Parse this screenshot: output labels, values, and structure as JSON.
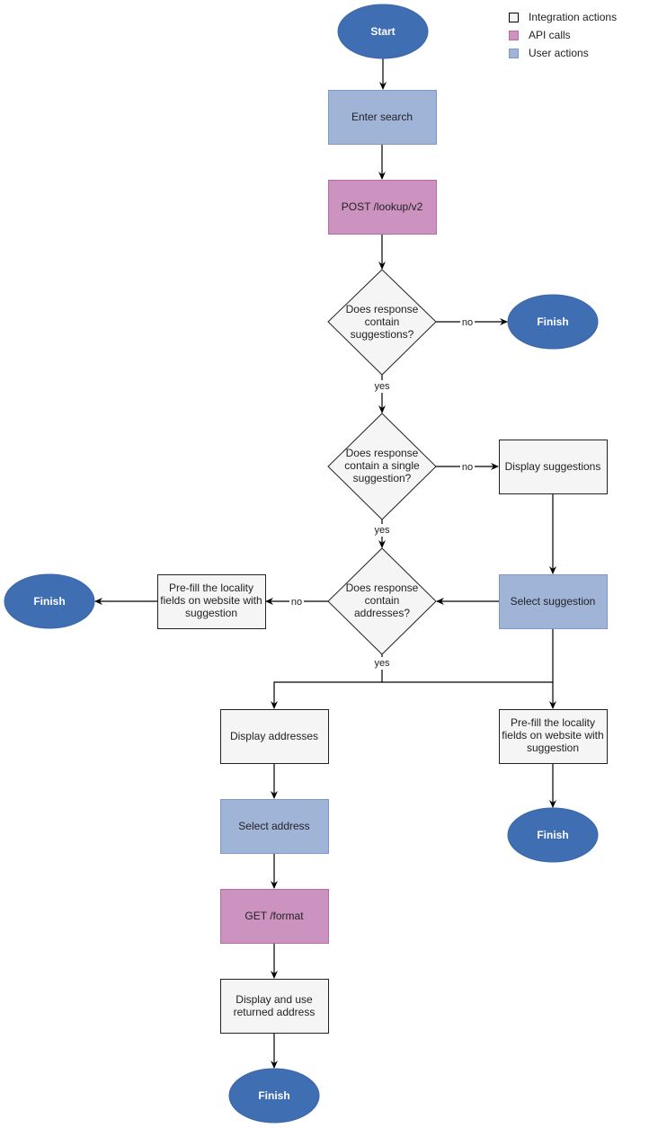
{
  "legend": [
    {
      "label": "Integration actions",
      "color": "#F5F5F5"
    },
    {
      "label": "API calls",
      "color": "#CC93C1"
    },
    {
      "label": "User actions",
      "color": "#A0B4D8"
    }
  ],
  "colors": {
    "terminal": "#3F6EB3",
    "integration": "#F5F5F5",
    "api": "#CC93C1",
    "user": "#A0B4D8"
  },
  "nodes": {
    "start": "Start",
    "enter_search": "Enter search",
    "post_lookup": "POST /lookup/v2",
    "decision_suggestions": [
      "Does response",
      "contain",
      "suggestions?"
    ],
    "finish": "Finish",
    "decision_single": [
      "Does response",
      "contain a single",
      "suggestion?"
    ],
    "display_suggestions": "Display suggestions",
    "decision_addresses": [
      "Does response",
      "contain",
      "addresses?"
    ],
    "select_suggestion": "Select suggestion",
    "prefill": [
      "Pre-fill the locality",
      "fields on website with",
      "suggestion"
    ],
    "display_addresses": "Display addresses",
    "select_address": "Select address",
    "get_format": "GET /format",
    "display_use": [
      "Display and use",
      "returned address"
    ]
  },
  "edge_labels": {
    "yes": "yes",
    "no": "no"
  }
}
